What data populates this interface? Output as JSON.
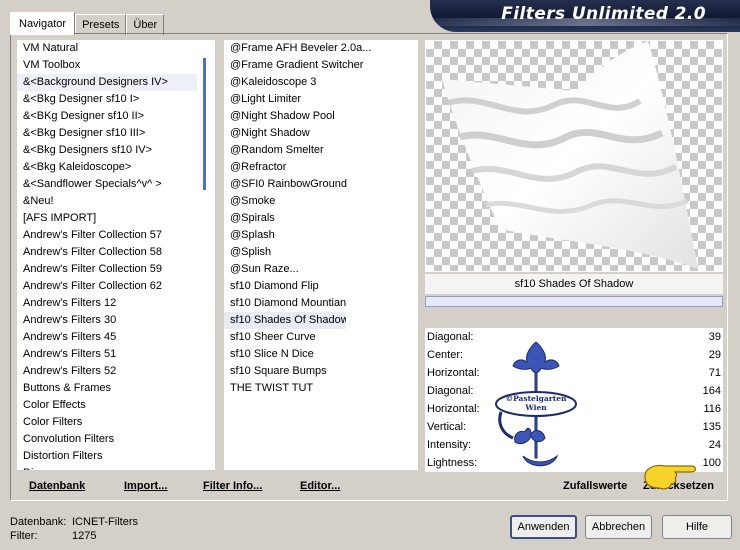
{
  "tabs": [
    {
      "label": "Navigator",
      "active": true
    },
    {
      "label": "Presets",
      "active": false
    },
    {
      "label": "Über",
      "active": false
    }
  ],
  "banner": {
    "title": "Filters Unlimited 2.0"
  },
  "categories": {
    "items": [
      "VM Natural",
      "VM Toolbox",
      "&<Background Designers IV>",
      "&<Bkg Designer sf10 I>",
      "&<BKg Designer sf10 II>",
      "&<Bkg Designer sf10 III>",
      "&<Bkg Designers sf10 IV>",
      "&<Bkg Kaleidoscope>",
      "&<Sandflower Specials^v^ >",
      "&Neu!",
      "[AFS IMPORT]",
      "Andrew's Filter Collection 57",
      "Andrew's Filter Collection 58",
      "Andrew's Filter Collection 59",
      "Andrew's Filter Collection 62",
      "Andrew's Filters 12",
      "Andrew's Filters 30",
      "Andrew's Filters 45",
      "Andrew's Filters 51",
      "Andrew's Filters 52",
      "Buttons & Frames",
      "Color Effects",
      "Color Filters",
      "Convolution Filters",
      "Distortion Filters",
      "Dis..."
    ],
    "selected_index": 2
  },
  "filters": {
    "items": [
      "@Frame AFH Beveler 2.0a...",
      "@Frame Gradient Switcher",
      "@Kaleidoscope 3",
      "@Light Limiter",
      "@Night Shadow Pool",
      "@Night Shadow",
      "@Random Smelter",
      "@Refractor",
      "@SFI0 RainbowGround",
      "@Smoke",
      "@Spirals",
      "@Splash",
      "@Splish",
      "@Sun Raze...",
      "sf10 Diamond Flip",
      "sf10 Diamond Mountian",
      "sf10 Shades Of Shadow",
      "sf10 Sheer Curve",
      "sf10 Slice N Dice",
      "sf10 Square Bumps",
      "THE TWIST TUT"
    ],
    "selected_index": 16
  },
  "preview": {
    "filter_name": "sf10 Shades Of Shadow"
  },
  "params": [
    {
      "label": "Diagonal:",
      "value": "39"
    },
    {
      "label": "Center:",
      "value": "29"
    },
    {
      "label": "Horizontal:",
      "value": "71"
    },
    {
      "label": "Diagonal:",
      "value": "164"
    },
    {
      "label": "Horizontal:",
      "value": "116"
    },
    {
      "label": "Vertical:",
      "value": "135"
    },
    {
      "label": "Intensity:",
      "value": "24"
    },
    {
      "label": "Lightness:",
      "value": "100"
    }
  ],
  "watermark": {
    "line1": "©Pastelgarten",
    "line2": "Wien"
  },
  "bottom_buttons": {
    "database": "Datenbank",
    "import": "Import...",
    "filter_info": "Filter Info...",
    "editor": "Editor...",
    "random": "Zufallswerte",
    "reset": "Zurücksetzen"
  },
  "status": {
    "db_label": "Datenbank:",
    "db_value": "ICNET-Filters",
    "filter_label": "Filter:",
    "filter_value": "1275"
  },
  "dialog_buttons": {
    "apply": "Anwenden",
    "cancel": "Abbrechen",
    "help": "Hilfe"
  },
  "colors": {
    "accent": "#3c4d90",
    "selection": "#eef0f8",
    "scroll_thumb": "#4d6fc9"
  }
}
